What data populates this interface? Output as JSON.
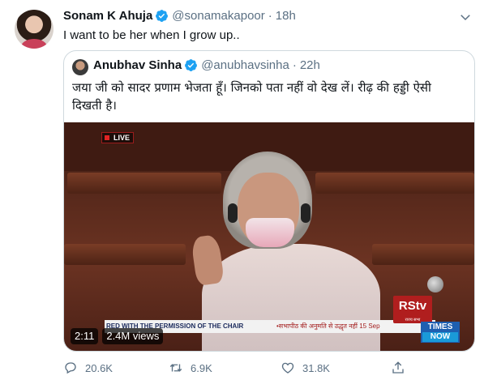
{
  "tweet": {
    "name": "Sonam K Ahuja",
    "handle": "@sonamakapoor",
    "separator": "·",
    "time": "18h",
    "text": "I want to be her when I grow up.."
  },
  "quoted_tweet": {
    "name": "Anubhav Sinha",
    "handle": "@anubhavsinha",
    "separator": "·",
    "time": "22h",
    "text": "जया जी को सादर प्रणाम भेजता हूँ। जिनको पता नहीं वो देख लें। रीढ़ की हड्डी ऐसी दिखती है।"
  },
  "video": {
    "live_label": "LIVE",
    "banner_left": "RED WITH THE PERMISSION OF THE CHAIR",
    "banner_right": "•सभापीठ की अनुमति से उद्धृत नहीं 15 Sep",
    "channel_logo": "RStv",
    "channel_sub": "राज्य सभा",
    "network_top": "TIMES",
    "network_bottom": "NOW",
    "duration": "2:11",
    "views": "2.4M views"
  },
  "actions": {
    "replies": "20.6K",
    "retweets": "6.9K",
    "likes": "31.8K"
  },
  "colors": {
    "verified": "#1da1f2",
    "muted": "#5b7083",
    "border": "#cfd9de"
  }
}
